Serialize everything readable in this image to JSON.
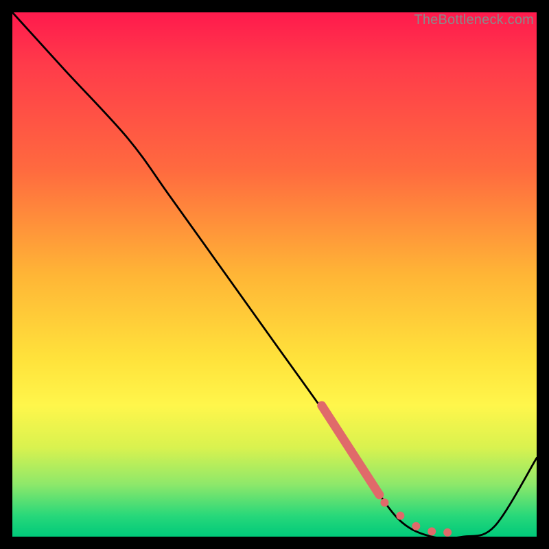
{
  "watermark": "TheBottleneck.com",
  "chart_data": {
    "type": "line",
    "title": "",
    "xlabel": "",
    "ylabel": "",
    "xlim": [
      0,
      100
    ],
    "ylim": [
      0,
      100
    ],
    "series": [
      {
        "name": "curve",
        "x": [
          0,
          10,
          22,
          30,
          40,
          50,
          60,
          68,
          74,
          80,
          86,
          92,
          100
        ],
        "y": [
          100,
          89,
          76,
          65,
          51,
          37,
          23,
          11,
          3,
          0,
          0,
          2,
          15
        ]
      }
    ],
    "highlight_segment": {
      "x": [
        59,
        70
      ],
      "y": [
        25,
        8
      ],
      "color": "#e06a6a"
    },
    "highlight_dots": {
      "points": [
        {
          "x": 71,
          "y": 6.5
        },
        {
          "x": 74,
          "y": 4
        },
        {
          "x": 77,
          "y": 2
        },
        {
          "x": 80,
          "y": 1
        },
        {
          "x": 83,
          "y": 0.8
        }
      ],
      "color": "#e06a6a"
    },
    "background_gradient": {
      "top": "#ff1a4d",
      "bottom": "#00c97a"
    }
  }
}
